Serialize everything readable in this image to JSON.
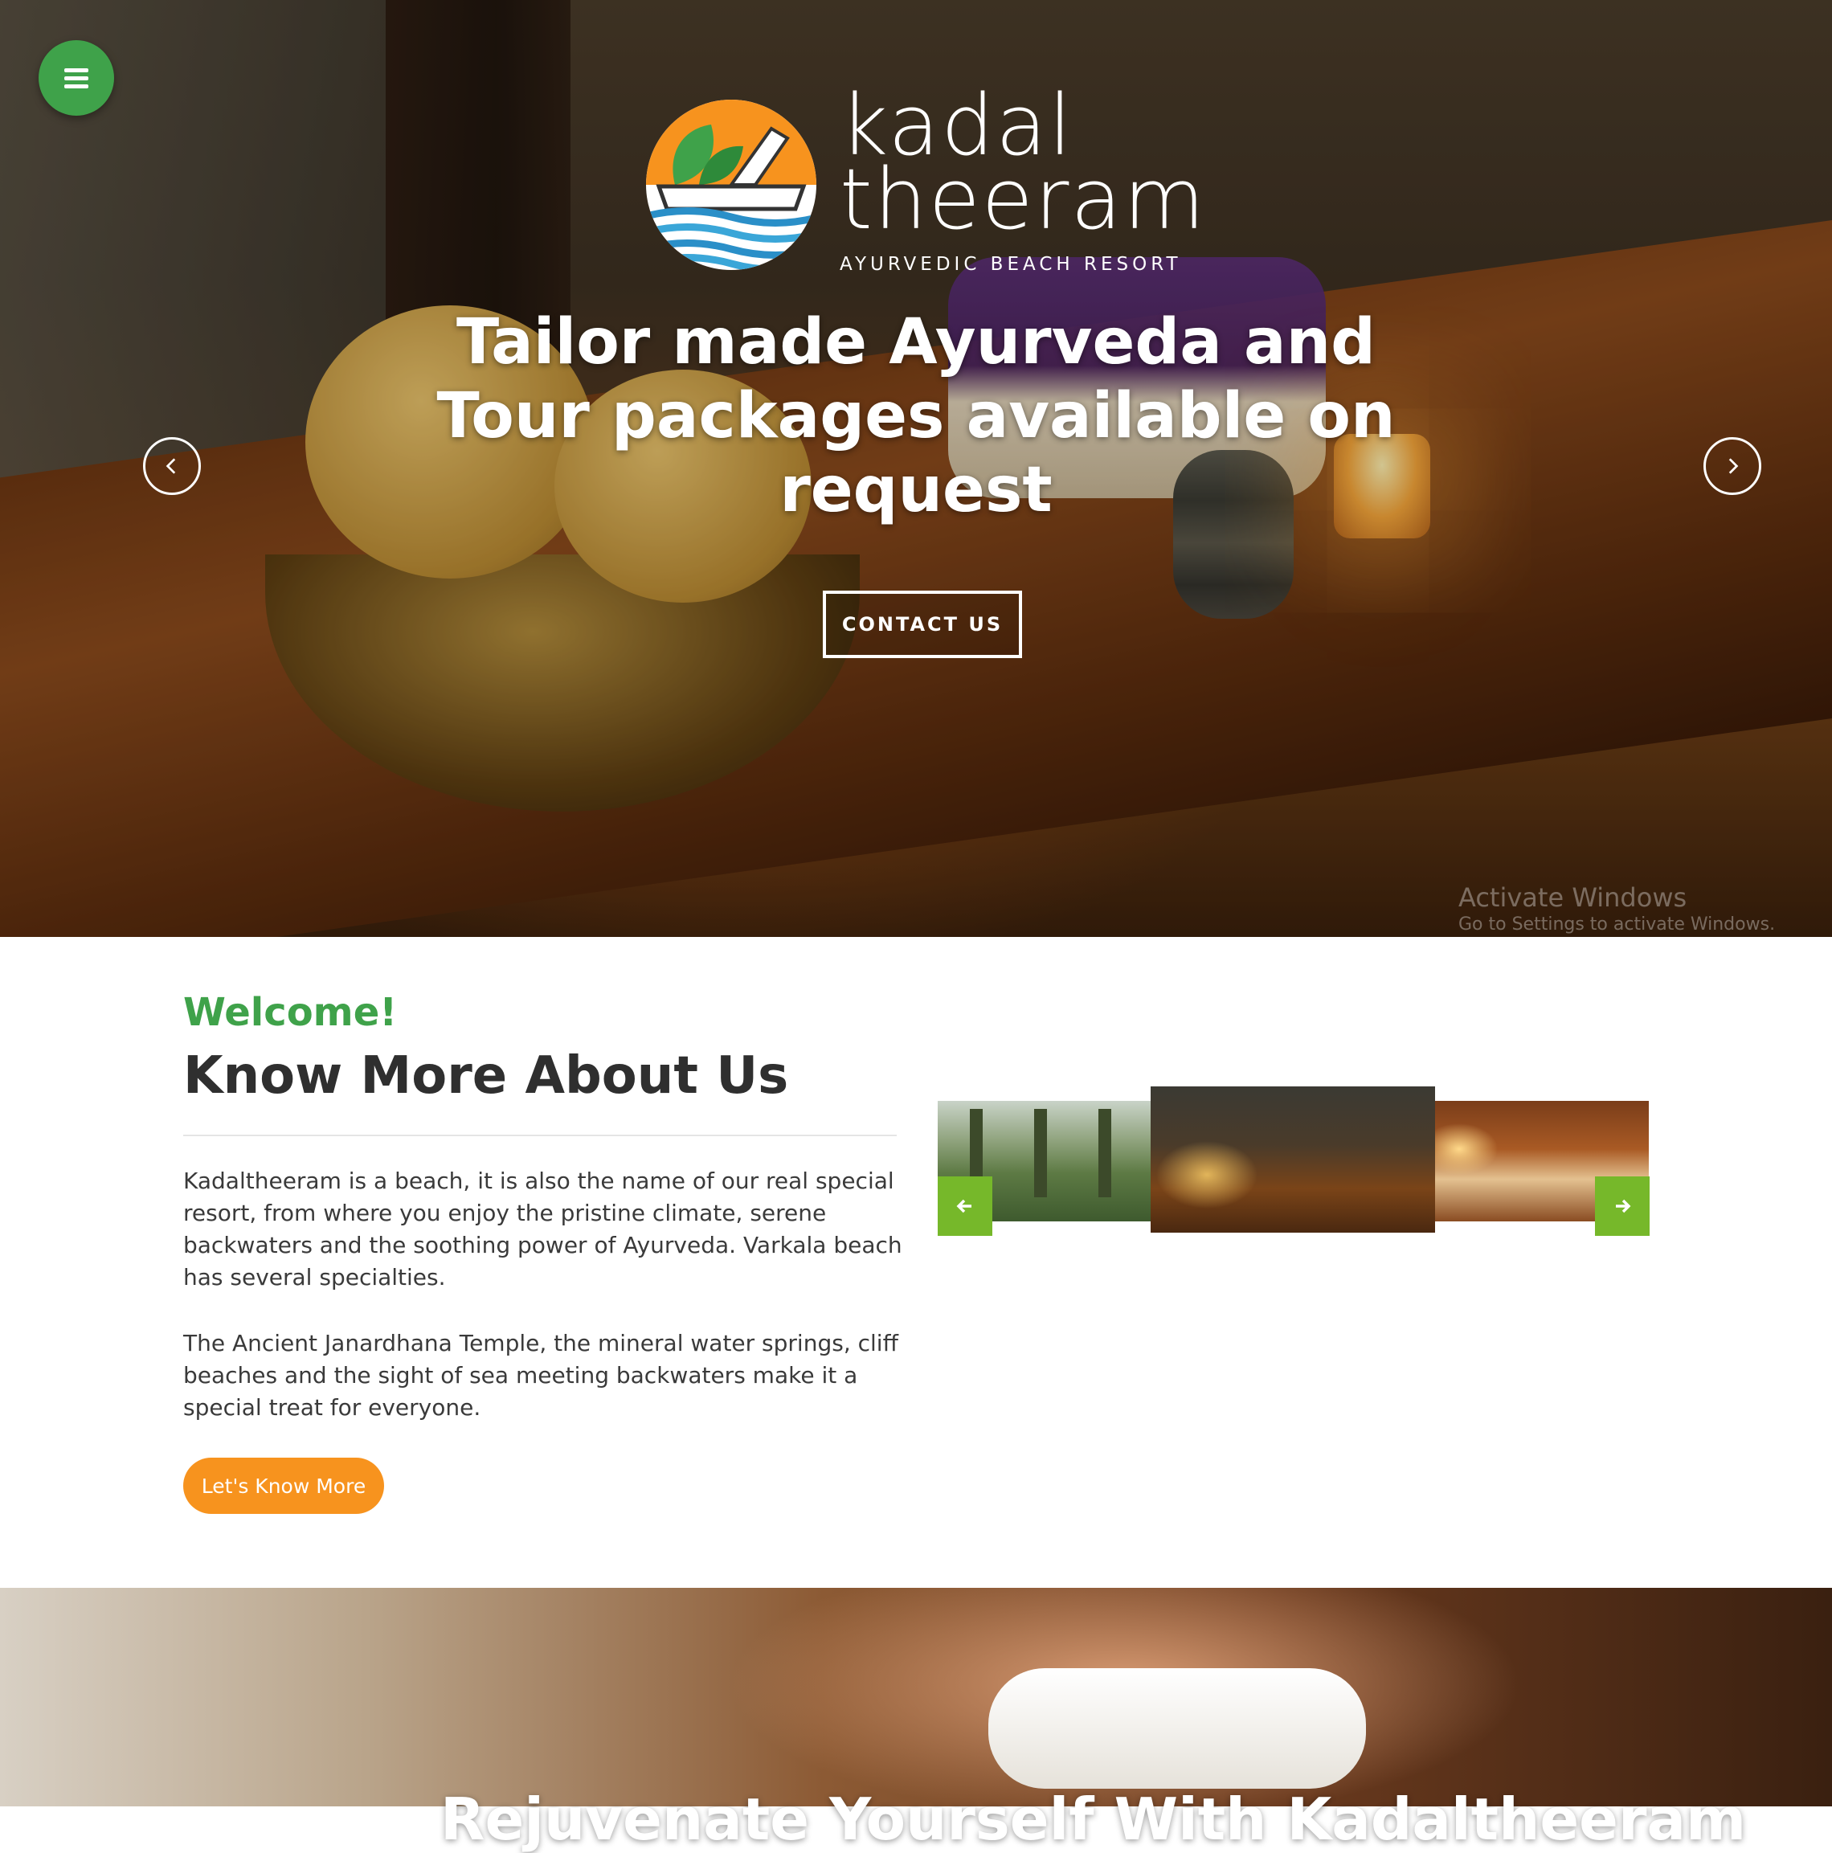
{
  "hero": {
    "logo": {
      "line1": "kadal",
      "line2": "theeram",
      "tagline": "AYURVEDIC BEACH RESORT",
      "colors": {
        "sun": "#f7931e",
        "leaf": "#3fa24a",
        "wave": "#2a8fc8"
      }
    },
    "title": "Tailor made Ayurveda and Tour packages available on request",
    "contact_label": "CONTACT US",
    "menu_icon": "hamburger-menu-icon",
    "prev_icon": "chevron-left-icon",
    "next_icon": "chevron-right-icon"
  },
  "watermark": {
    "line1": "Activate Windows",
    "line2": "Go to Settings to activate Windows."
  },
  "about": {
    "welcome": "Welcome!",
    "title": "Know More About Us",
    "para1": "Kadaltheeram is a beach, it is also the name of our real special resort, from where you enjoy the pristine climate, serene backwaters and the soothing power of Ayurveda. Varkala beach has several specialties.",
    "para2": "The Ancient Janardhana Temple, the mineral water springs, cliff beaches and the sight of sea meeting backwaters make it a special treat for everyone.",
    "button_label": "Let's Know More"
  },
  "gallery": {
    "prev_icon": "arrow-left-icon",
    "next_icon": "arrow-right-icon",
    "accent": "#76b82a"
  },
  "band": {
    "title": "Rejuvenate Yourself With Kadaltheeram"
  },
  "colors": {
    "green": "#3fa24a",
    "orange": "#f7931e",
    "dark_text": "#2f2f2f"
  }
}
